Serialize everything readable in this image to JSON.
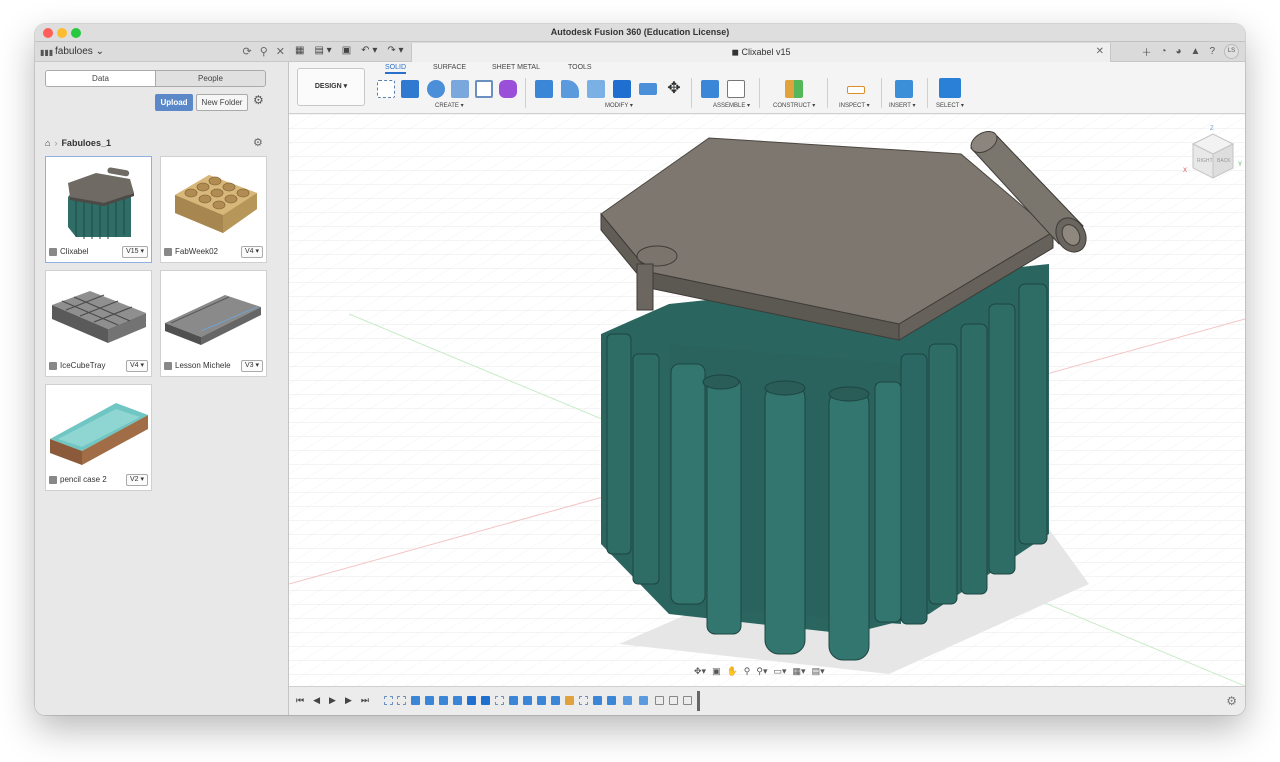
{
  "window": {
    "title": "Autodesk Fusion 360 (Education License)"
  },
  "data_panel": {
    "team_name": "fabuloes",
    "segments": [
      "Data",
      "People"
    ],
    "upload_label": "Upload",
    "new_folder_label": "New Folder",
    "breadcrumb": "Fabuloes_1",
    "files": [
      {
        "name": "Clixabel",
        "version": "V15"
      },
      {
        "name": "FabWeek02",
        "version": "V4"
      },
      {
        "name": "IceCubeTray",
        "version": "V4"
      },
      {
        "name": "Lesson Michele",
        "version": "V3"
      },
      {
        "name": "pencil case 2",
        "version": "V2"
      }
    ]
  },
  "document": {
    "tab_title": "Clixabel v15",
    "user_initials": "LS"
  },
  "toolbar": {
    "workspace": "DESIGN",
    "tabs": [
      "SOLID",
      "SURFACE",
      "SHEET METAL",
      "TOOLS"
    ],
    "groups": [
      "CREATE",
      "MODIFY",
      "ASSEMBLE",
      "CONSTRUCT",
      "INSPECT",
      "INSERT",
      "SELECT"
    ]
  },
  "viewcube": {
    "faces": [
      "RIGHT",
      "BACK"
    ],
    "axes": [
      "Z",
      "X",
      "Y"
    ]
  },
  "colors": {
    "model_body": "#2f6d66",
    "model_lid": "#7c766e",
    "accent": "#2a6fc9"
  }
}
